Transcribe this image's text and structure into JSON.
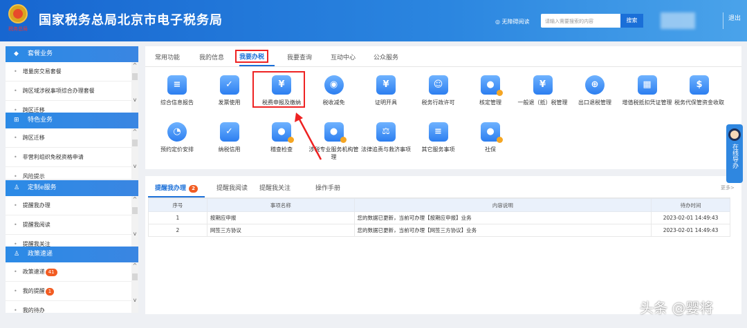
{
  "header": {
    "seal_text": "税务总局",
    "title": "国家税务总局北京市电子税务局",
    "accessible": "无障碍阅读",
    "search_placeholder": "请输入需要搜索的内容",
    "search_btn": "搜索",
    "logout": "退出"
  },
  "sidebar": [
    {
      "title": "套餐业务",
      "icon": "cube-icon",
      "items": [
        "增量房交易套餐",
        "跨区域涉税事项综合办理套餐",
        "跨区迁移"
      ]
    },
    {
      "title": "特色业务",
      "icon": "grid-icon",
      "items": [
        "跨区迁移",
        "非营利组织免税资格申请",
        "风险提示"
      ]
    },
    {
      "title": "定制e服务",
      "icon": "user-icon",
      "items": [
        "提醒我办理",
        "提醒我阅读",
        "提醒我关注"
      ]
    },
    {
      "title": "政策速递",
      "icon": "user-icon",
      "items": [
        "政策速递",
        "我的提醒",
        "我的待办"
      ],
      "badges": [
        "41",
        "1"
      ]
    }
  ],
  "tabs": [
    "常用功能",
    "我的信息",
    "我要办税",
    "我要查询",
    "互动中心",
    "公众服务"
  ],
  "active_tab": "我要办税",
  "functions": [
    {
      "label": "综合信息报告",
      "g": "≡"
    },
    {
      "label": "发票使用",
      "g": "✓"
    },
    {
      "label": "税费申报及缴纳",
      "g": "¥"
    },
    {
      "label": "税收减免",
      "g": "◉"
    },
    {
      "label": "证明开具",
      "g": "¥"
    },
    {
      "label": "税务行政许可",
      "g": "☺"
    },
    {
      "label": "核定管理",
      "g": "●"
    },
    {
      "label": "一般退（抵）税管理",
      "g": "¥"
    },
    {
      "label": "出口退税管理",
      "g": "⊕"
    },
    {
      "label": "增值税抵扣凭证管理",
      "g": "▦"
    },
    {
      "label": "税务代保管资金收取",
      "g": "$"
    },
    {
      "label": "预约定价安排",
      "g": "◔"
    },
    {
      "label": "纳税信用",
      "g": "✓"
    },
    {
      "label": "稽查检查",
      "g": "●"
    },
    {
      "label": "涉税专业服务机构管理",
      "g": "●"
    },
    {
      "label": "法律追责与救济事项",
      "g": "⚖"
    },
    {
      "label": "其它服务事项",
      "g": "≡"
    },
    {
      "label": "社保",
      "g": "●"
    }
  ],
  "reminders": {
    "tabs": [
      "提醒我办理",
      "提醒我阅读",
      "提醒我关注",
      "操作手册"
    ],
    "badge": "2",
    "more": "更多>",
    "columns": [
      "序号",
      "事项名称",
      "内容说明",
      "待办时间"
    ],
    "rows": [
      [
        "1",
        "按期应申报",
        "您的数据已更新，当前可办理【按期应申报】业务",
        "2023-02-01 14:49:43"
      ],
      [
        "2",
        "网签三方协议",
        "您的数据已更新，当前可办理【网签三方协议】业务",
        "2023-02-01 14:49:43"
      ]
    ]
  },
  "float_help": "在线导办",
  "watermark": "头条 @婴将",
  "colors": {
    "primary": "#1a6fd8",
    "highlight": "#e22222",
    "badge": "#f25c22"
  }
}
